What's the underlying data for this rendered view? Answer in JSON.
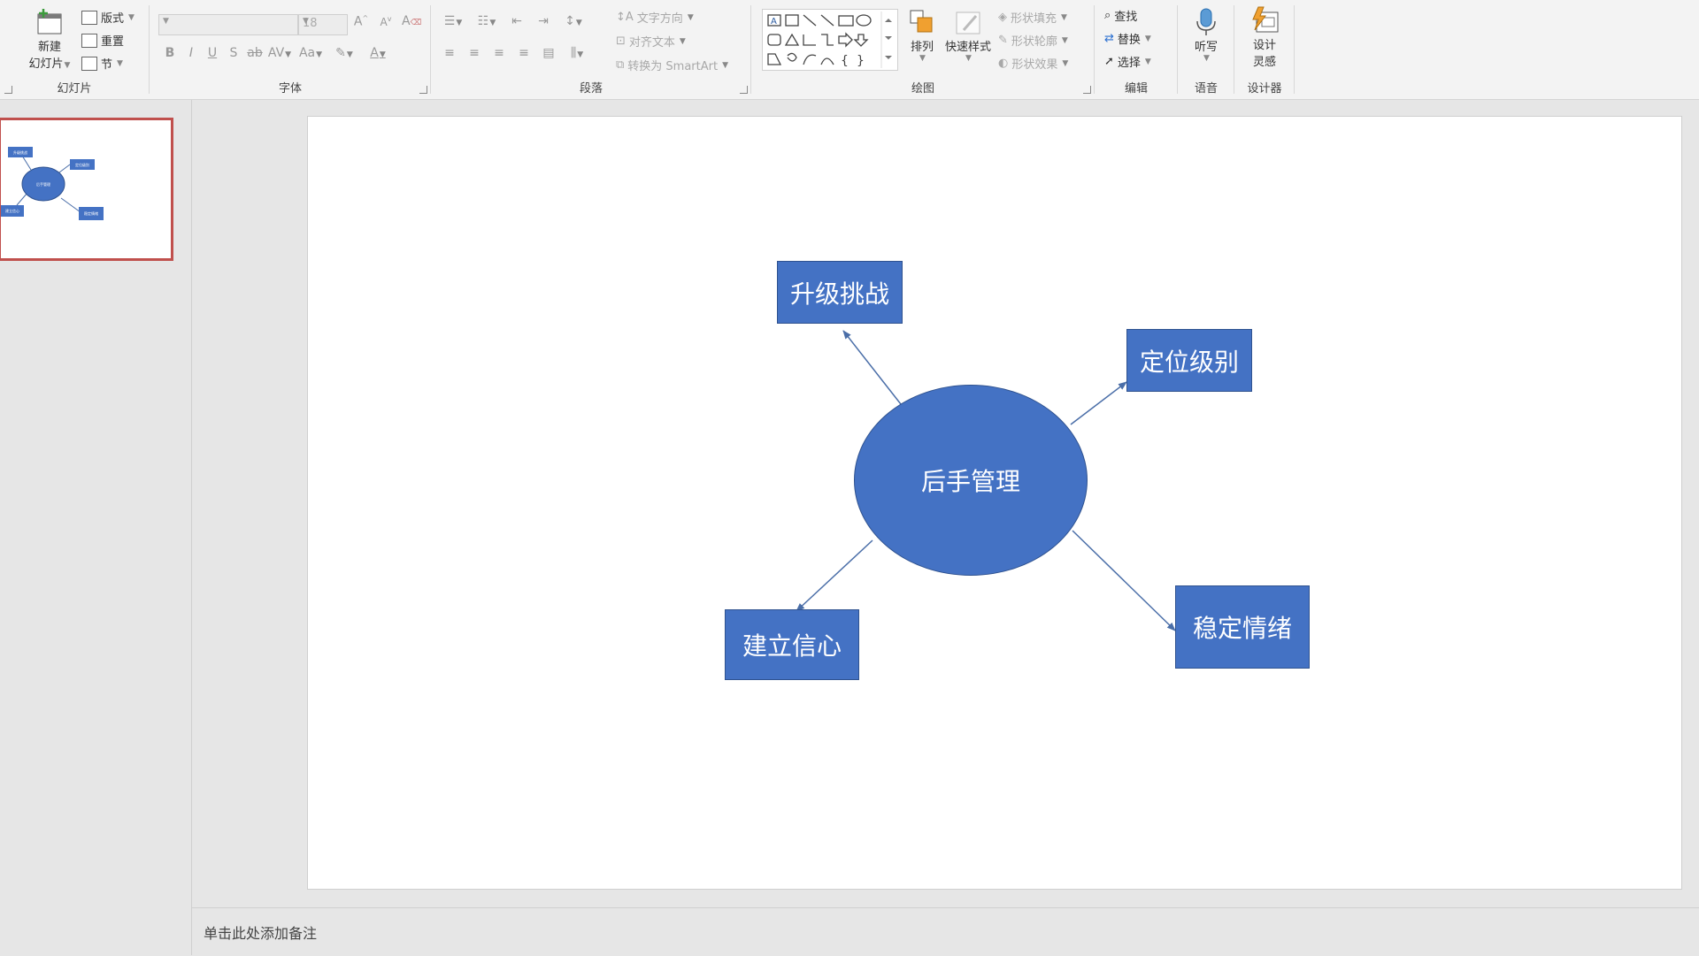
{
  "ribbon": {
    "slides_group": {
      "label": "幻灯片",
      "new_slide_line1": "新建",
      "new_slide_line2": "幻灯片",
      "layout": "版式",
      "reset": "重置",
      "section": "节"
    },
    "font_group": {
      "label": "字体",
      "font_name": "",
      "font_size": "18"
    },
    "paragraph_group": {
      "label": "段落",
      "text_direction": "文字方向",
      "align_text": "对齐文本",
      "convert_smartart": "转换为 SmartArt"
    },
    "drawing_group": {
      "label": "绘图",
      "arrange": "排列",
      "quick_styles": "快速样式",
      "shape_fill": "形状填充",
      "shape_outline": "形状轮廓",
      "shape_effects": "形状效果"
    },
    "editing_group": {
      "label": "编辑",
      "find": "查找",
      "replace": "替换",
      "select": "选择"
    },
    "voice_group": {
      "label": "语音",
      "dictate": "听写"
    },
    "designer_group": {
      "label": "设计器",
      "design_ideas_line1": "设计",
      "design_ideas_line2": "灵感"
    }
  },
  "thumbnail": {
    "center": "后手管理",
    "n1": "升级挑战",
    "n2": "定位级别",
    "n3": "建立信心",
    "n4": "稳定情绪"
  },
  "slide": {
    "center": "后手管理",
    "node_top_left": "升级挑战",
    "node_top_right": "定位级别",
    "node_bottom_left": "建立信心",
    "node_bottom_right": "稳定情绪"
  },
  "notes": {
    "placeholder": "单击此处添加备注"
  },
  "colors": {
    "shape_fill": "#4472c4",
    "shape_border": "#2f528f",
    "selection": "#c0504d"
  }
}
